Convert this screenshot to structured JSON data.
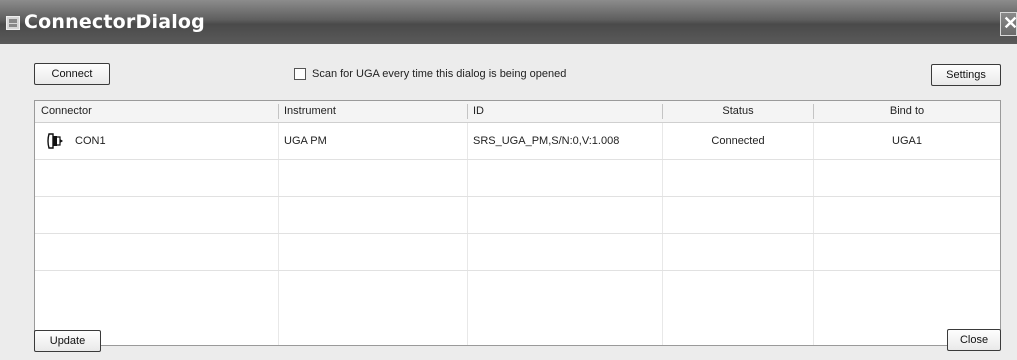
{
  "window": {
    "title": "ConnectorDialog",
    "close_glyph": "✕"
  },
  "toolbar": {
    "connect_label": "Connect",
    "scan_label": "Scan for UGA every time this dialog is being opened",
    "scan_checked": false,
    "settings_label": "Settings"
  },
  "table": {
    "columns": [
      "Connector",
      "Instrument",
      "ID",
      "Status",
      "Bind to"
    ],
    "rows": [
      {
        "connector": "CON1",
        "connector_icon": "connector-plug-icon",
        "instrument": "UGA PM",
        "id": "SRS_UGA_PM,S/N:0,V:1.008",
        "status": "Connected",
        "bind_to": "UGA1"
      },
      {
        "connector": "",
        "instrument": "",
        "id": "",
        "status": "",
        "bind_to": ""
      },
      {
        "connector": "",
        "instrument": "",
        "id": "",
        "status": "",
        "bind_to": ""
      },
      {
        "connector": "",
        "instrument": "",
        "id": "",
        "status": "",
        "bind_to": ""
      },
      {
        "connector": "",
        "instrument": "",
        "id": "",
        "status": "",
        "bind_to": ""
      }
    ]
  },
  "footer": {
    "update_label": "Update",
    "close_label": "Close"
  },
  "colors": {
    "titlebar": "#5e5e5e",
    "title_text": "#ffffff",
    "dialog_background": "#ececec",
    "grid_background": "#ffffff"
  }
}
